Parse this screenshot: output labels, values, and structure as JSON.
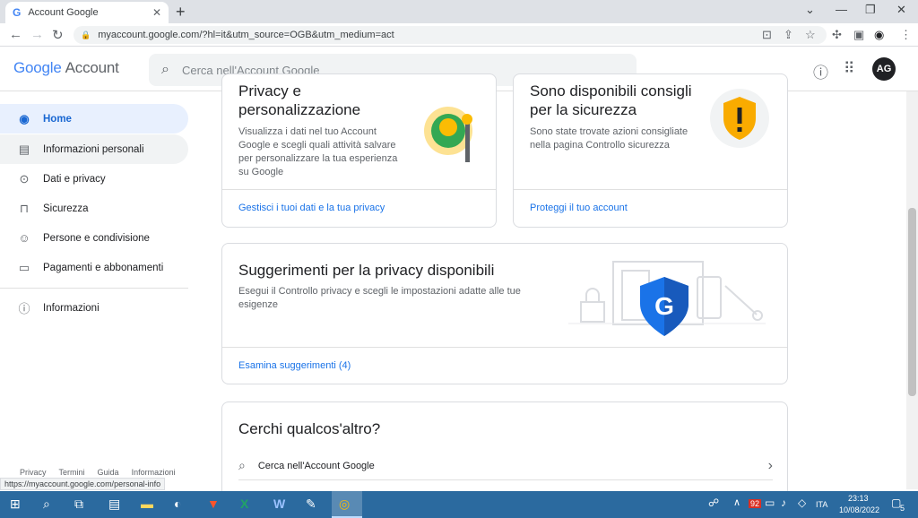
{
  "browser": {
    "tab_title": "Account Google",
    "tab_close": "✕",
    "new_tab": "+",
    "url": "myaccount.google.com/?hl=it&utm_source=OGB&utm_medium=act",
    "status_url": "https://myaccount.google.com/personal-info"
  },
  "header": {
    "logo_google": "Google",
    "logo_account": "Account",
    "search_placeholder": "Cerca nell'Account Google",
    "avatar_initials": "AG"
  },
  "sidebar": {
    "items": [
      {
        "label": "Home",
        "icon": "account-circle-icon"
      },
      {
        "label": "Informazioni personali",
        "icon": "id-card-icon"
      },
      {
        "label": "Dati e privacy",
        "icon": "toggle-icon"
      },
      {
        "label": "Sicurezza",
        "icon": "lock-icon"
      },
      {
        "label": "Persone e condivisione",
        "icon": "people-icon"
      },
      {
        "label": "Pagamenti e abbonamenti",
        "icon": "credit-card-icon"
      },
      {
        "label": "Informazioni",
        "icon": "info-icon"
      }
    ],
    "footer": [
      "Privacy",
      "Termini",
      "Guida",
      "Informazioni"
    ]
  },
  "cards": {
    "privacy": {
      "title": "Privacy e personalizzazione",
      "description": "Visualizza i dati nel tuo Account Google e scegli quali attività salvare per personalizzare la tua esperienza su Google",
      "link": "Gestisci i tuoi dati e la tua privacy"
    },
    "security": {
      "title": "Sono disponibili consigli per la sicurezza",
      "description": "Sono state trovate azioni consigliate nella pagina Controllo sicurezza",
      "link": "Proteggi il tuo account"
    },
    "suggestions": {
      "title": "Suggerimenti per la privacy disponibili",
      "description": "Esegui il Controllo privacy e scegli le impostazioni adatte alle tue esigenze",
      "link": "Esamina suggerimenti (4)"
    },
    "more": {
      "title": "Cerchi qualcos'altro?",
      "search_row": "Cerca nell'Account Google"
    }
  },
  "taskbar": {
    "language": "ITA",
    "time": "23:13",
    "date": "10/08/2022",
    "badge": "92",
    "notification_count": "5"
  },
  "colors": {
    "accent": "#1a73e8",
    "active_bg": "#e8f0fe",
    "taskbar": "#2b6a9f"
  }
}
